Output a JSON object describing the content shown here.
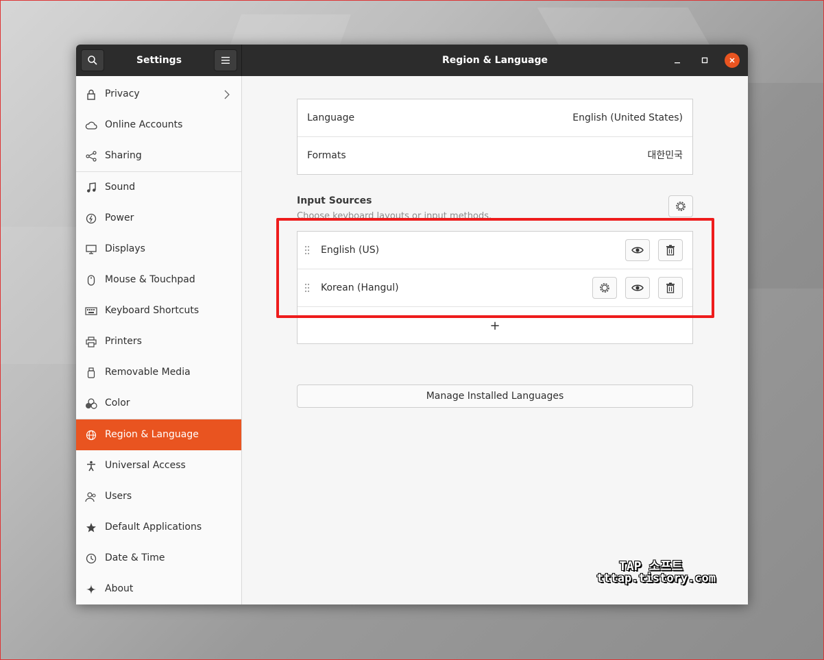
{
  "window": {
    "sidebar_title": "Settings",
    "main_title": "Region & Language"
  },
  "sidebar": {
    "items": [
      {
        "label": "Privacy",
        "icon": "lock-icon",
        "has_chevron": true
      },
      {
        "label": "Online Accounts",
        "icon": "cloud-icon"
      },
      {
        "label": "Sharing",
        "icon": "share-icon"
      },
      {
        "label": "Sound",
        "icon": "music-note-icon"
      },
      {
        "label": "Power",
        "icon": "power-icon"
      },
      {
        "label": "Displays",
        "icon": "display-icon"
      },
      {
        "label": "Mouse & Touchpad",
        "icon": "mouse-icon"
      },
      {
        "label": "Keyboard Shortcuts",
        "icon": "keyboard-icon"
      },
      {
        "label": "Printers",
        "icon": "printer-icon"
      },
      {
        "label": "Removable Media",
        "icon": "usb-drive-icon"
      },
      {
        "label": "Color",
        "icon": "color-circles-icon"
      },
      {
        "label": "Region & Language",
        "icon": "globe-icon",
        "active": true
      },
      {
        "label": "Universal Access",
        "icon": "accessibility-icon"
      },
      {
        "label": "Users",
        "icon": "users-icon"
      },
      {
        "label": "Default Applications",
        "icon": "star-icon"
      },
      {
        "label": "Date & Time",
        "icon": "clock-icon"
      },
      {
        "label": "About",
        "icon": "sparkle-icon"
      }
    ]
  },
  "language_settings": {
    "language_label": "Language",
    "language_value": "English (United States)",
    "formats_label": "Formats",
    "formats_value": "대한민국"
  },
  "input_sources": {
    "title": "Input Sources",
    "subtitle": "Choose keyboard layouts or input methods.",
    "sources": [
      {
        "name": "English (US)",
        "has_settings": false
      },
      {
        "name": "Korean (Hangul)",
        "has_settings": true
      }
    ],
    "add_label": "+"
  },
  "manage_button": "Manage Installed Languages",
  "watermark": {
    "line1": "TAP 소프트",
    "line2": "tttap.tistory.com"
  },
  "colors": {
    "accent": "#e95420",
    "titlebar": "#2c2c2c",
    "highlight": "#ee1c1c"
  }
}
